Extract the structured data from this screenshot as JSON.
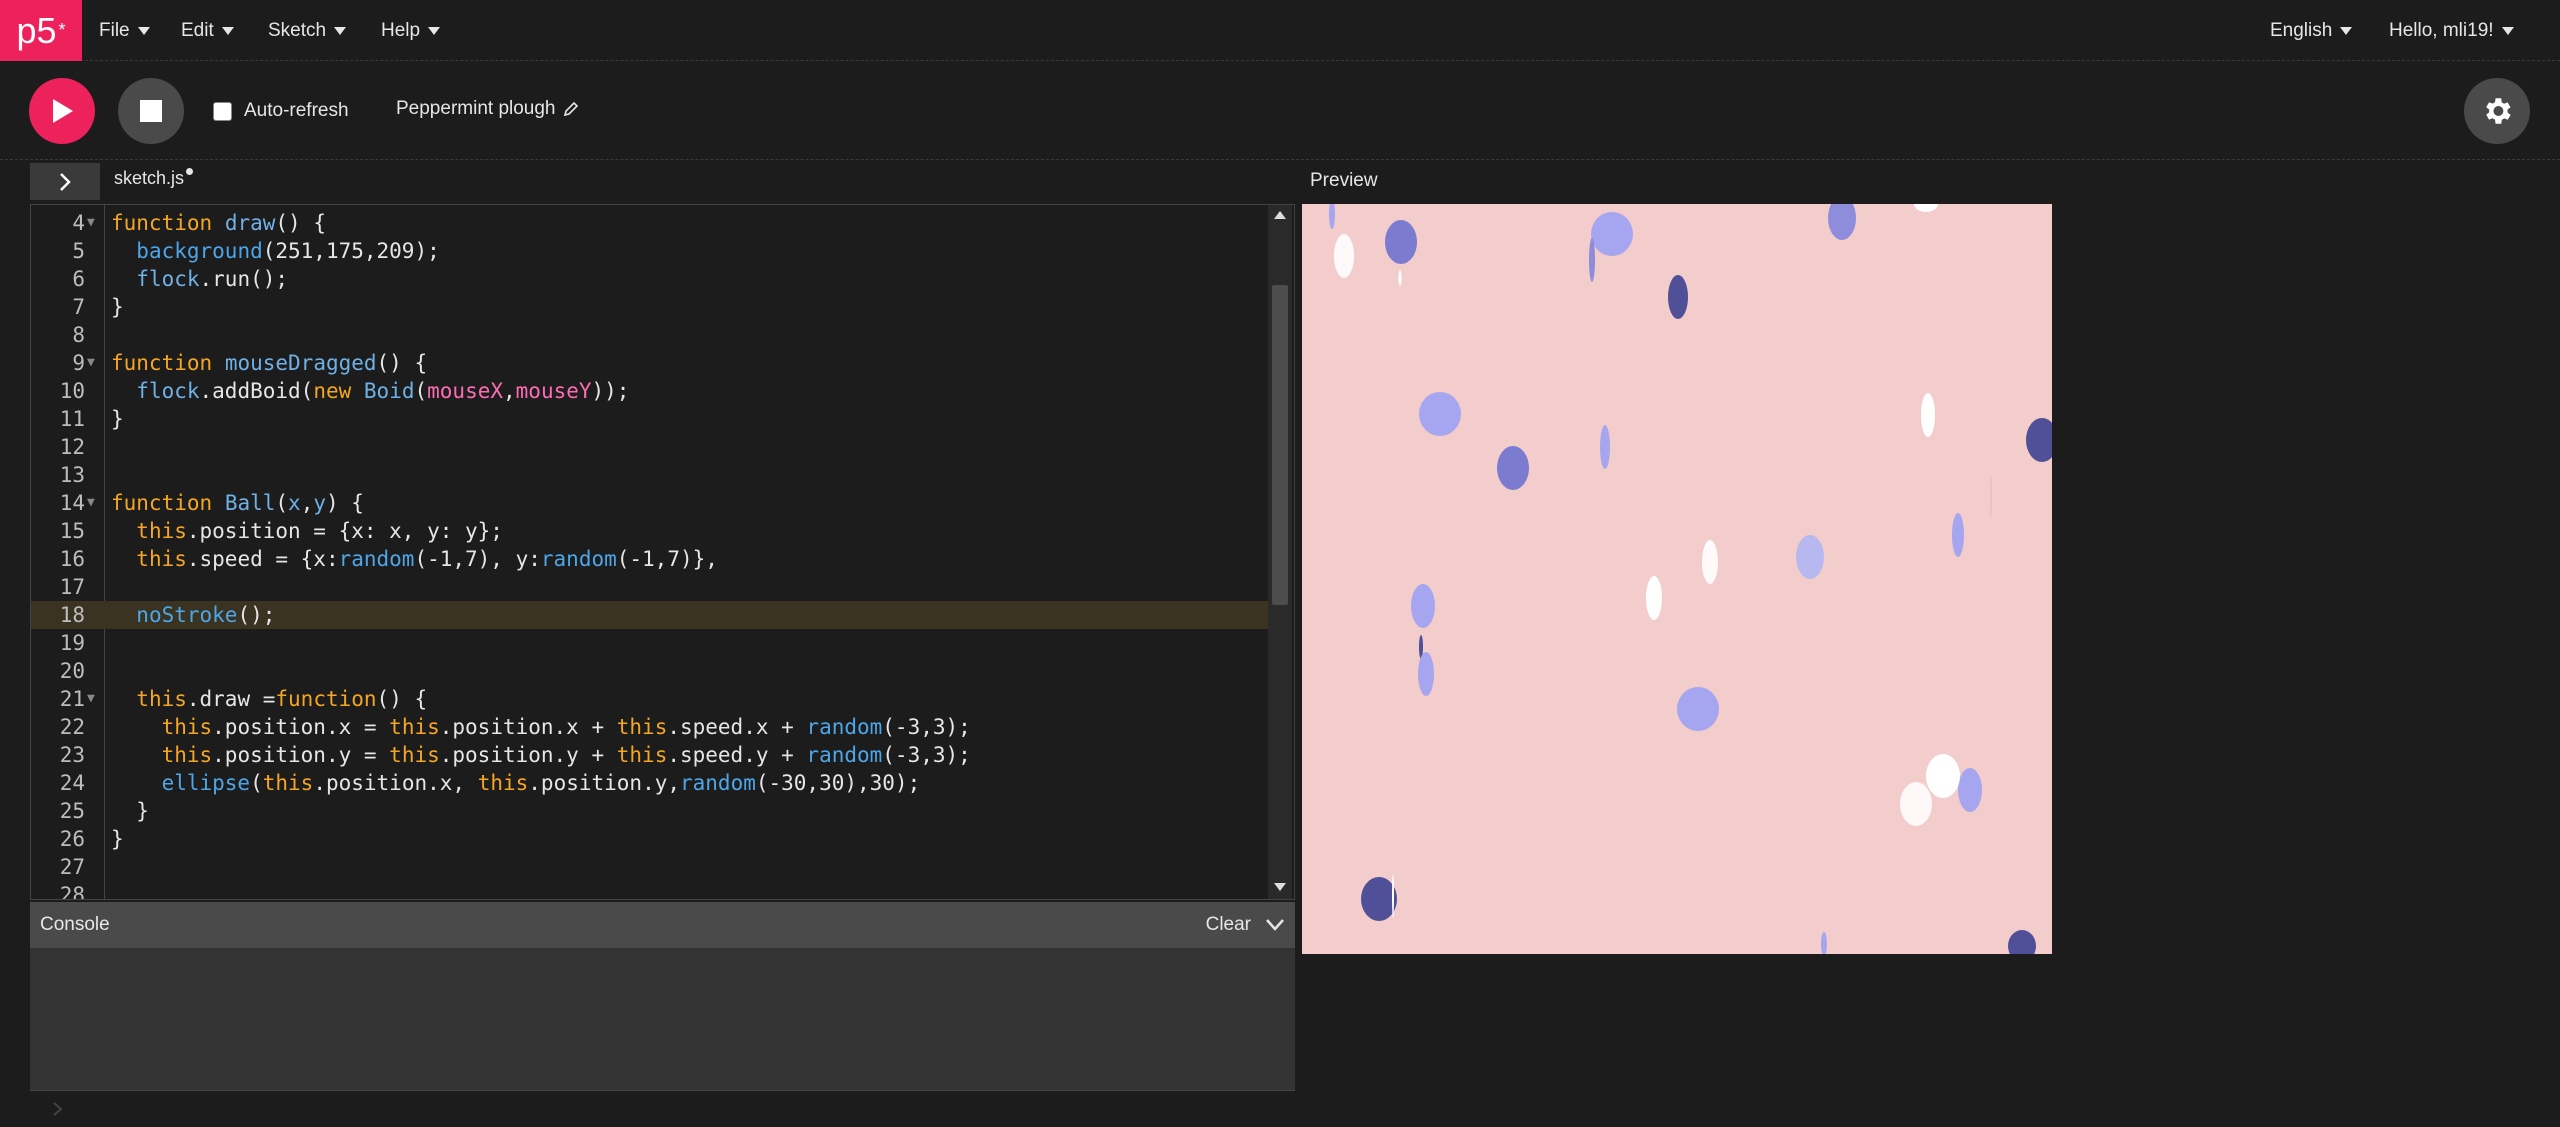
{
  "nav": {
    "logo": "p5",
    "logo_sup": "*",
    "menu": [
      "File",
      "Edit",
      "Sketch",
      "Help"
    ],
    "language": "English",
    "user": "Hello, mli19!"
  },
  "toolbar": {
    "auto_refresh_label": "Auto-refresh",
    "auto_refresh_checked": false,
    "sketch_name": "Peppermint plough"
  },
  "editor": {
    "file_name": "sketch.js",
    "active_line": 18,
    "lines": [
      {
        "n": "4",
        "fold": true,
        "code": "function draw() {"
      },
      {
        "n": "5",
        "code": "  background(251,175,209);"
      },
      {
        "n": "6",
        "code": "  flock.run();"
      },
      {
        "n": "7",
        "code": "}"
      },
      {
        "n": "8",
        "code": ""
      },
      {
        "n": "9",
        "fold": true,
        "code": "function mouseDragged() {"
      },
      {
        "n": "10",
        "code": "  flock.addBoid(new Boid(mouseX,mouseY));"
      },
      {
        "n": "11",
        "code": "}"
      },
      {
        "n": "12",
        "code": ""
      },
      {
        "n": "13",
        "code": ""
      },
      {
        "n": "14",
        "fold": true,
        "code": "function Ball(x,y) {"
      },
      {
        "n": "15",
        "code": "  this.position = {x: x, y: y};"
      },
      {
        "n": "16",
        "code": "  this.speed = {x:random(-1,7), y:random(-1,7)},"
      },
      {
        "n": "17",
        "code": ""
      },
      {
        "n": "18",
        "code": "  noStroke();"
      },
      {
        "n": "19",
        "code": ""
      },
      {
        "n": "20",
        "code": ""
      },
      {
        "n": "21",
        "fold": true,
        "code": "  this.draw =function() {"
      },
      {
        "n": "22",
        "code": "    this.position.x = this.position.x + this.speed.x + random(-3,3);"
      },
      {
        "n": "23",
        "code": "    this.position.y = this.position.y + this.speed.y + random(-3,3);"
      },
      {
        "n": "24",
        "code": "    ellipse(this.position.x, this.position.y,random(-30,30),30);"
      },
      {
        "n": "25",
        "code": "  }"
      },
      {
        "n": "26",
        "code": "}"
      },
      {
        "n": "27",
        "code": ""
      },
      {
        "n": "28",
        "code": ""
      }
    ]
  },
  "console": {
    "label": "Console",
    "clear_label": "Clear"
  },
  "preview": {
    "label": "Preview",
    "background": "#f3cccc"
  }
}
